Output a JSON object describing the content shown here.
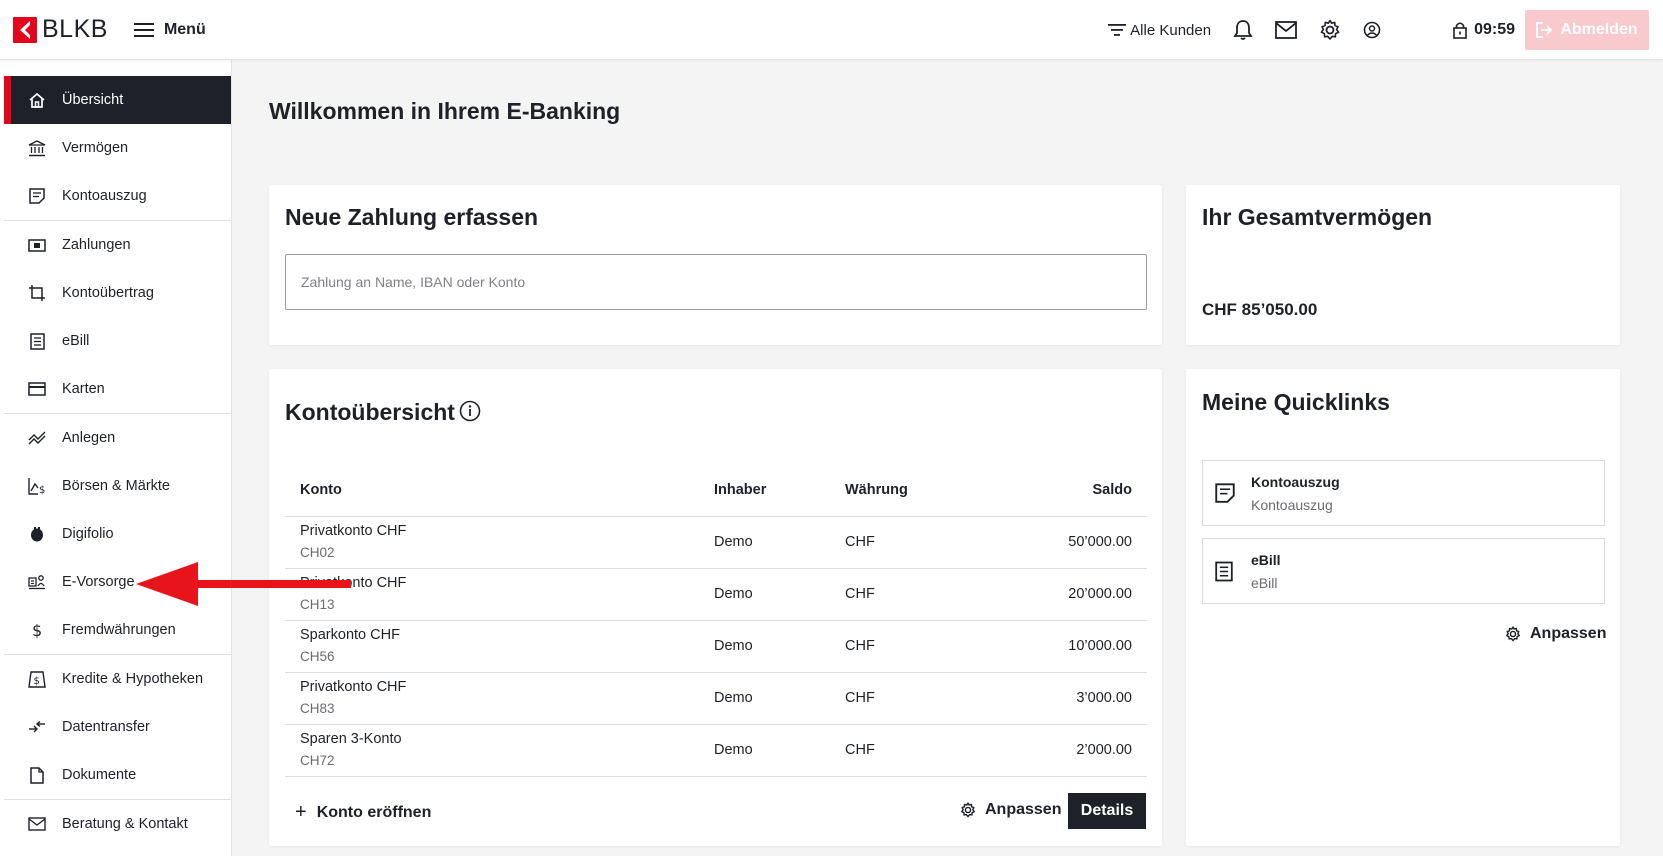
{
  "header": {
    "brand": "BLKB",
    "menu_label": "Menü",
    "filter_label": "Alle Kunden",
    "session_time": "09:59",
    "logout_label": "Abmelden"
  },
  "sidebar": {
    "items": [
      {
        "label": "Übersicht",
        "icon": "home-icon",
        "active": true
      },
      {
        "label": "Vermögen",
        "icon": "bank-icon"
      },
      {
        "label": "Kontoauszug",
        "icon": "statement-icon"
      },
      {
        "label": "Zahlungen",
        "icon": "money-icon"
      },
      {
        "label": "Kontoübertrag",
        "icon": "transfer-icon"
      },
      {
        "label": "eBill",
        "icon": "ebill-icon"
      },
      {
        "label": "Karten",
        "icon": "card-icon"
      },
      {
        "label": "Anlegen",
        "icon": "chart-icon"
      },
      {
        "label": "Börsen & Märkte",
        "icon": "market-icon"
      },
      {
        "label": "Digifolio",
        "icon": "digifolio-icon"
      },
      {
        "label": "E-Vorsorge",
        "icon": "pension-icon"
      },
      {
        "label": "Fremdwährungen",
        "icon": "dollar-icon"
      },
      {
        "label": "Kredite & Hypotheken",
        "icon": "loan-icon"
      },
      {
        "label": "Datentransfer",
        "icon": "data-transfer-icon"
      },
      {
        "label": "Dokumente",
        "icon": "document-icon"
      },
      {
        "label": "Beratung & Kontakt",
        "icon": "mail-icon"
      }
    ]
  },
  "main": {
    "welcome": "Willkommen in Ihrem E-Banking",
    "payment": {
      "title": "Neue Zahlung erfassen",
      "placeholder": "Zahlung an Name, IBAN oder Konto"
    },
    "total": {
      "title": "Ihr Gesamtvermögen",
      "value": "CHF 85’050.00"
    },
    "accounts": {
      "title": "Kontoübersicht",
      "columns": [
        "Konto",
        "Inhaber",
        "Währung",
        "Saldo"
      ],
      "rows": [
        {
          "name": "Privatkonto CHF",
          "iban": "CH02",
          "owner": "Demo",
          "currency": "CHF",
          "balance": "50’000.00"
        },
        {
          "name": "Privatkonto CHF",
          "iban": "CH13",
          "owner": "Demo",
          "currency": "CHF",
          "balance": "20’000.00"
        },
        {
          "name": "Sparkonto CHF",
          "iban": "CH56",
          "owner": "Demo",
          "currency": "CHF",
          "balance": "10’000.00"
        },
        {
          "name": "Privatkonto CHF",
          "iban": "CH83",
          "owner": "Demo",
          "currency": "CHF",
          "balance": "3’000.00"
        },
        {
          "name": "Sparen 3-Konto",
          "iban": "CH72",
          "owner": "Demo",
          "currency": "CHF",
          "balance": "2’000.00"
        }
      ],
      "open_label": "Konto eröffnen",
      "customize_label": "Anpassen",
      "details_label": "Details"
    },
    "quicklinks": {
      "title": "Meine Quicklinks",
      "items": [
        {
          "title": "Kontoauszug",
          "subtitle": "Kontoauszug",
          "icon": "statement-icon"
        },
        {
          "title": "eBill",
          "subtitle": "eBill",
          "icon": "ebill-icon"
        }
      ],
      "customize_label": "Anpassen"
    }
  },
  "colors": {
    "brand_red": "#e3051b",
    "dark": "#1f2128",
    "logout_disabled": "#f8c9cd",
    "annotation_arrow": "#e8141c"
  }
}
